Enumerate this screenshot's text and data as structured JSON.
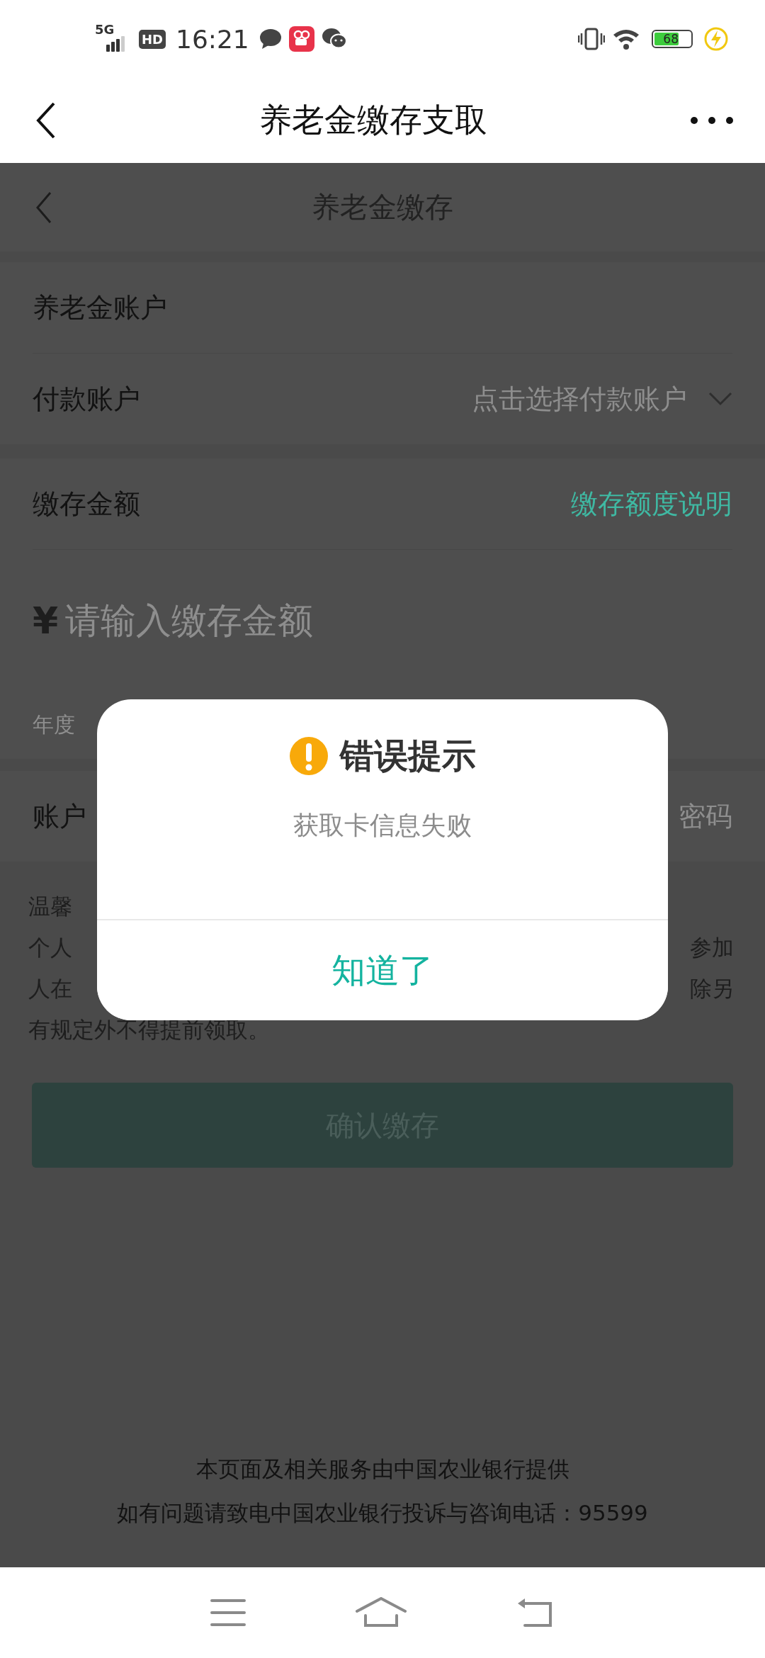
{
  "status_bar": {
    "network": "5G",
    "hd_badge": "HD",
    "time": "16:21",
    "battery": "68"
  },
  "app_bar": {
    "title": "养老金缴存支取"
  },
  "page": {
    "header": {
      "title": "养老金缴存"
    },
    "account_rows": [
      {
        "label": "养老金账户"
      },
      {
        "label": "付款账户",
        "placeholder": "点击选择付款账户"
      }
    ],
    "amount": {
      "label": "缴存金额",
      "link": "缴存额度说明",
      "currency": "¥",
      "placeholder": "请输入缴存金额",
      "note": "年度"
    },
    "password_row": {
      "label": "账户",
      "value": "密码"
    },
    "tips": {
      "title": "温馨",
      "lines": [
        {
          "left": "个人",
          "right": "参加"
        },
        {
          "left": "人在",
          "right": "除另"
        }
      ],
      "last_line": "有规定外不得提前领取。"
    },
    "confirm_button": "确认缴存",
    "footer": [
      "本页面及相关服务由中国农业银行提供",
      "如有问题请致电中国农业银行投诉与咨询电话：95599"
    ]
  },
  "dialog": {
    "title": "错误提示",
    "message": "获取卡信息失败",
    "button": "知道了"
  }
}
